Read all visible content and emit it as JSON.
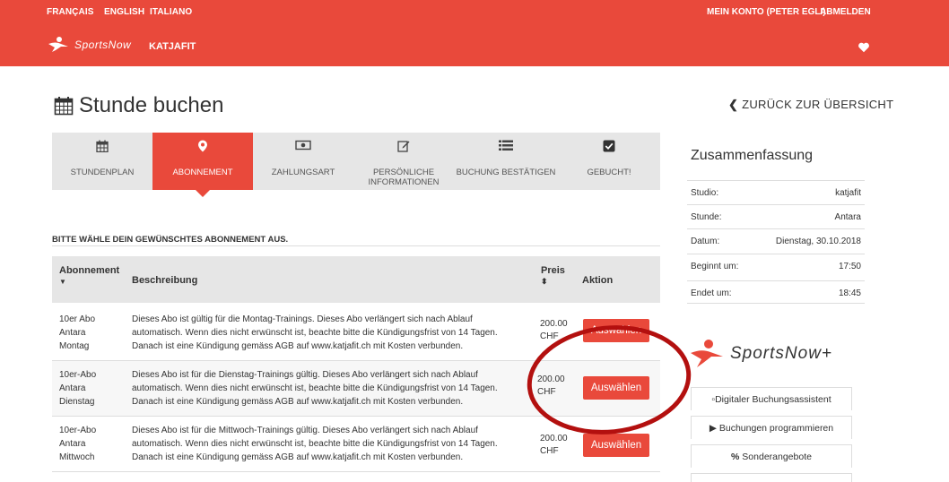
{
  "languages": [
    "FRANÇAIS",
    "ENGLISH",
    "ITALIANO"
  ],
  "account": {
    "my_account": "MEIN KONTO (PETER EGLI)",
    "logout": "ABMELDEN"
  },
  "brand": {
    "logo_text": "SportsNow",
    "club": "KATJAFIT"
  },
  "page": {
    "title": "Stunde buchen",
    "back_link": "ZURÜCK ZUR ÜBERSICHT"
  },
  "steps": [
    {
      "label": "STUNDENPLAN",
      "icon": "calendar-icon"
    },
    {
      "label": "ABONNEMENT",
      "icon": "map-marker-icon",
      "active": true
    },
    {
      "label": "ZAHLUNGSART",
      "icon": "money-icon"
    },
    {
      "label": "PERSÖNLICHE",
      "label2": "INFORMATIONEN",
      "icon": "edit-icon"
    },
    {
      "label": "BUCHUNG BESTÄTIGEN",
      "icon": "list-icon"
    },
    {
      "label": "GEBUCHT!",
      "icon": "check-square-icon"
    }
  ],
  "prompt": "BITTE WÄHLE DEIN GEWÜNSCHTES ABONNEMENT AUS.",
  "table": {
    "headers": {
      "subscription": "Abonnement",
      "description": "Beschreibung",
      "price": "Preis",
      "action": "Aktion"
    },
    "rows": [
      {
        "name": [
          "10er Abo",
          "Antara",
          "Montag"
        ],
        "desc": [
          "Dieses Abo ist gültig für die Montag-Trainings. Dieses Abo verlängert sich nach Ablauf",
          "automatisch. Wenn dies nicht erwünscht ist, beachte bitte die Kündigungsfrist von 14 Tagen.",
          "Danach ist eine Kündigung gemäss AGB auf www.katjafit.ch mit Kosten verbunden."
        ],
        "price": "200.00",
        "currency": "CHF",
        "button": "Auswählen"
      },
      {
        "name": [
          "10er-Abo",
          "Antara",
          "Dienstag"
        ],
        "desc": [
          "Dieses Abo ist für die Dienstag-Trainings gültig. Dieses Abo verlängert sich nach Ablauf",
          "automatisch. Wenn dies nicht erwünscht ist, beachte bitte die Kündigungsfrist von 14 Tagen.",
          "Danach ist eine Kündigung gemäss AGB auf www.katjafit.ch mit Kosten verbunden."
        ],
        "price": "200.00",
        "currency": "CHF",
        "button": "Auswählen"
      },
      {
        "name": [
          "10er-Abo",
          "Antara",
          "Mittwoch"
        ],
        "desc": [
          "Dieses Abo ist für die Mittwoch-Trainings gültig. Dieses Abo verlängert sich nach Ablauf",
          "automatisch. Wenn dies nicht erwünscht ist, beachte bitte die Kündigungsfrist von 14 Tagen.",
          "Danach ist eine Kündigung gemäss AGB auf www.katjafit.ch mit Kosten verbunden."
        ],
        "price": "200.00",
        "currency": "CHF",
        "button": "Auswählen"
      }
    ]
  },
  "summary": {
    "title": "Zusammenfassung",
    "rows": [
      {
        "k": "Studio:",
        "v": "katjafit"
      },
      {
        "k": "Stunde:",
        "v": "Antara"
      },
      {
        "k": "Datum:",
        "v": "Dienstag, 30.10.2018"
      },
      {
        "k": "Beginnt um:",
        "v": "17:50"
      },
      {
        "k": "Endet um:",
        "v": "18:45"
      }
    ]
  },
  "sportsnow_plus": {
    "logo_text": "SportsNow+",
    "items": [
      "Digitaler Buchungsassistent",
      "Buchungen programmieren",
      "Sonderangebote"
    ]
  },
  "colors": {
    "accent": "#e9493b",
    "annotation": "#b3100f",
    "step_bg": "#e6e6e6"
  }
}
